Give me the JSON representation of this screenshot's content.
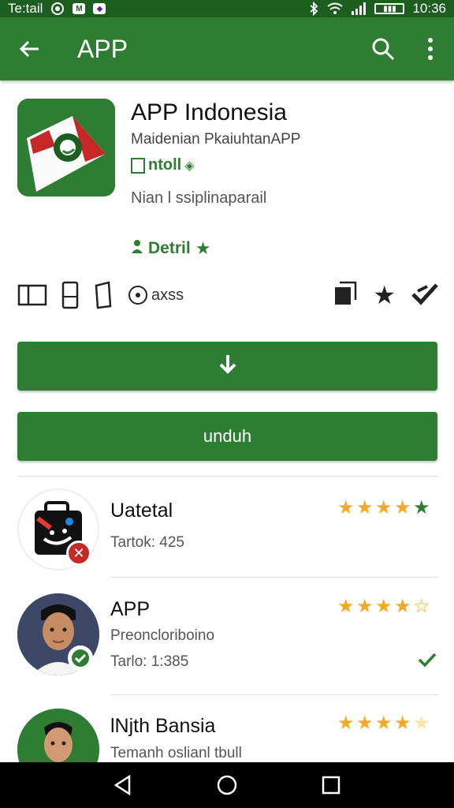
{
  "status_bar": {
    "carrier": "Te:tail",
    "time": "10:36",
    "icons": [
      "whatsapp-icon",
      "gmail-icon",
      "app-notification-icon",
      "bluetooth-icon",
      "wifi-icon",
      "signal-icon",
      "battery-icon"
    ]
  },
  "app_bar": {
    "title": "APP",
    "icons": [
      "back-arrow-icon",
      "search-icon",
      "more-vert-icon"
    ]
  },
  "app": {
    "name": "APP Indonesia",
    "developer": "Maidenian PkaiuhtanAPP",
    "install_label": "ntoll",
    "tagline": "Nian l ssiplinaparail",
    "detail_label": "Detril"
  },
  "icon_strip": {
    "text": "axss",
    "icons": [
      "book-icon",
      "phone-icon",
      "tablet-icon",
      "target-icon",
      "copy-icon",
      "star-icon",
      "verified-icon"
    ]
  },
  "buttons": {
    "download_icon": "download-arrow-icon",
    "unduh_label": "unduh"
  },
  "list": [
    {
      "title": "Uatetal",
      "sub1": "Tartok: 425",
      "sub2": "",
      "rating": 5,
      "star_colors": [
        "#f9a825",
        "#f9a825",
        "#f9a825",
        "#f9a825",
        "#2e7d32"
      ],
      "badge": "close-badge-icon",
      "badge_color": "#c62828"
    },
    {
      "title": "APP",
      "sub1": "Preoncloriboino",
      "sub2": "Tarlo: 1:385",
      "rating": 3.5,
      "badge": "check-badge-icon",
      "badge_color": "#2e7d32",
      "trailing": "check-icon"
    },
    {
      "title": "lNjth Bansia",
      "sub1": "Temanh oslianl tbull",
      "sub2": "",
      "rating": 3.5
    }
  ],
  "nav_bar": {
    "icons": [
      "back-triangle-icon",
      "home-circle-icon",
      "recents-square-icon"
    ]
  },
  "colors": {
    "primary": "#2e7d32",
    "primary_dark": "#1b5e20",
    "star": "#f9a825"
  }
}
